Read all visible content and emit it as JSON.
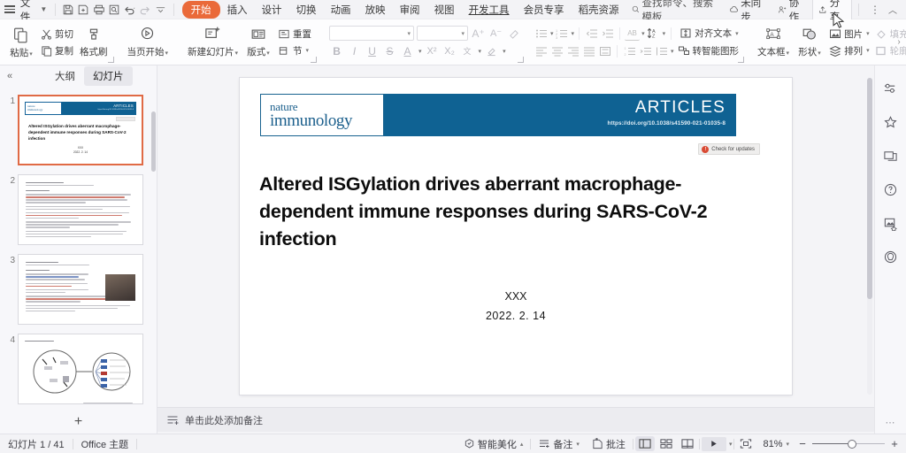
{
  "menubar": {
    "file": "文件",
    "tabs": [
      {
        "label": "开始",
        "active": true
      },
      {
        "label": "插入",
        "active": false
      },
      {
        "label": "设计",
        "active": false
      },
      {
        "label": "切换",
        "active": false
      },
      {
        "label": "动画",
        "active": false
      },
      {
        "label": "放映",
        "active": false
      },
      {
        "label": "审阅",
        "active": false
      },
      {
        "label": "视图",
        "active": false
      },
      {
        "label": "开发工具",
        "active": false
      },
      {
        "label": "会员专享",
        "active": false
      },
      {
        "label": "稻壳资源",
        "active": false
      }
    ],
    "search": "查找命令、搜索模板",
    "sync": "未同步",
    "collab": "协作",
    "share": "分享",
    "more": "⋮",
    "collapse": "︿",
    "quick_icons": [
      "save-icon",
      "save-as-icon",
      "print-icon",
      "print-preview-icon",
      "undo-icon",
      "redo-icon",
      "customize-icon"
    ]
  },
  "ribbon": {
    "clipboard": {
      "paste": "粘贴",
      "cut": "剪切",
      "copy": "复制",
      "format_painter": "格式刷"
    },
    "slideshow": {
      "from_current": "当页开始"
    },
    "slides": {
      "new_slide": "新建幻灯片",
      "layout": "版式",
      "reset": "重置",
      "section": "节"
    },
    "font": {
      "font_family": "",
      "font_size": "",
      "grow": "A",
      "shrink": "A",
      "clear_format": "clear-format-icon",
      "bold": "B",
      "italic": "I",
      "underline": "U",
      "strikethrough": "S",
      "font_color": "A",
      "superscript": "X²",
      "subscript": "X₂",
      "pinyin": "文",
      "highlight": "highlight-icon"
    },
    "paragraph": {
      "align_text": "对齐文本",
      "convert_smartart": "转智能图形"
    },
    "drawing": {
      "textbox": "文本框",
      "shape": "形状",
      "picture": "图片",
      "arrange": "排列",
      "fill": "填充",
      "outline": "轮廓"
    }
  },
  "leftpanel": {
    "collapse": "«",
    "tab_outline": "大纲",
    "tab_slides": "幻灯片",
    "slides": [
      {
        "num": "1",
        "selected": true
      },
      {
        "num": "2",
        "selected": false
      },
      {
        "num": "3",
        "selected": false
      },
      {
        "num": "4",
        "selected": false
      }
    ],
    "add_slide": "+"
  },
  "slide": {
    "journal_line1": "nature",
    "journal_line2": "immunology",
    "section": "ARTICLES",
    "doi": "https://doi.org/10.1038/s41590-021-01035-8",
    "check_updates": "Check for updates",
    "title": "Altered ISGylation drives aberrant macrophage-dependent immune responses during SARS-CoV-2 infection",
    "author": "XXX",
    "date": "2022. 2. 14"
  },
  "thumb1": {
    "journal_line1": "nature",
    "journal_line2": "immunology",
    "section": "ARTICLES",
    "doi": "https://doi.org/10.1038/s41590-021-01035-8",
    "title": "Altered ISGylation drives aberrant macrophage-dependent immune responses during SARS-CoV-2 infection",
    "author": "XXX",
    "date": "2022. 2. 14"
  },
  "rail": {
    "icons": [
      "settings-sliders-icon",
      "magic-star-icon",
      "duplicate-icon",
      "help-icon",
      "image-effects-icon",
      "shield-icon"
    ],
    "more": "⋯"
  },
  "notes": {
    "placeholder": "单击此处添加备注"
  },
  "statusbar": {
    "slide_count": "幻灯片 1 / 41",
    "theme": "Office 主题",
    "beautify": "智能美化",
    "notes": "备注",
    "comment": "批注",
    "views": [
      "normal-view-icon",
      "slide-sorter-icon",
      "reading-view-icon"
    ],
    "play": "▶",
    "fit_window": "fit-to-window-icon",
    "zoom": "81%",
    "zoom_out": "−",
    "zoom_in": "+"
  },
  "colors": {
    "accent_orange": "#ea6a3a",
    "journal_blue": "#0f6293",
    "selection_border": "#e06a45"
  }
}
